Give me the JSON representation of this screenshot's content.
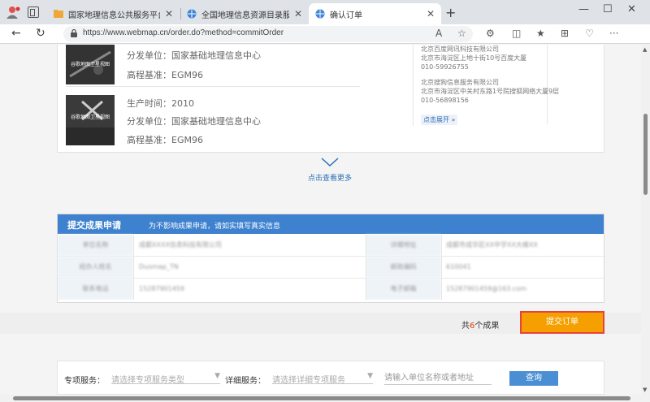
{
  "browser": {
    "tabs": [
      {
        "title": "国家地理信息公共服务平台 天地图",
        "active": false
      },
      {
        "title": "全国地理信息资源目录服务系统",
        "active": false
      },
      {
        "title": "确认订单",
        "active": true
      }
    ],
    "url": "https://www.webmap.cn/order.do?method=commitOrder"
  },
  "products": [
    {
      "thumb_label": "谷歌地图卫星视图",
      "lines": [
        "分发单位：国家基础地理信息中心",
        "高程基准：EGM96"
      ]
    },
    {
      "thumb_label": "谷歌地图卫星视图",
      "lines": [
        "生产时间：2010",
        "分发单位：国家基础地理信息中心",
        "高程基准：EGM96"
      ]
    }
  ],
  "vendors": [
    [
      "北京市海淀区上地十街10号百度大厦",
      "010-59926755"
    ],
    [
      "北京搜狗信息服务有限公司",
      "北京市海淀区中关村东路1号院搜狐网络大厦9层",
      "010-56898156"
    ]
  ],
  "vendor_top_partial": "北京百度网讯科技有限公司",
  "expand_label": "点击展开",
  "view_more": "点击查看更多",
  "form": {
    "title": "提交成果申请",
    "note": "为不影响成果申请，请如实填写真实信息",
    "rows": [
      [
        "单位名称",
        "成都XXXX信息科技有限公司",
        "详细地址",
        "成都市成华区XX中学XX大楼XX"
      ],
      [
        "经办人姓名",
        "Duomap_TN",
        "邮政编码",
        "610041"
      ],
      [
        "联系电话",
        "15287901459",
        "电子邮箱",
        "15287901459@163.com"
      ]
    ]
  },
  "summary": {
    "prefix": "共",
    "count": "6",
    "suffix": "个成果"
  },
  "submit_label": "提交订单",
  "filter": {
    "special_label": "专项服务：",
    "special_placeholder": "请选择专项服务类型",
    "detail_label": "详细服务：",
    "detail_placeholder": "请选择详细专项服务",
    "unit_placeholder": "请输入单位名称或者地址",
    "query_label": "查询"
  }
}
